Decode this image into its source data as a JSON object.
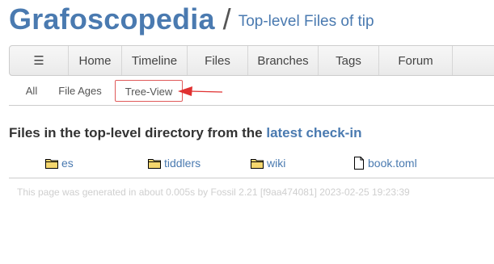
{
  "header": {
    "site_title": "Grafoscopedia",
    "separator": "/",
    "page_title": "Top-level Files of tip"
  },
  "mainmenu": {
    "hamburger": "☰",
    "items": [
      "Home",
      "Timeline",
      "Files",
      "Branches",
      "Tags",
      "Forum"
    ]
  },
  "submenu": {
    "items": [
      "All",
      "File Ages",
      "Tree-View"
    ],
    "active": "Tree-View"
  },
  "section": {
    "heading_text": "Files in the top-level directory from the ",
    "heading_link": "latest check-in"
  },
  "files": [
    {
      "name": "es",
      "type": "folder",
      "icon": "folder-icon"
    },
    {
      "name": "tiddlers",
      "type": "folder",
      "icon": "folder-icon"
    },
    {
      "name": "wiki",
      "type": "folder",
      "icon": "folder-icon"
    },
    {
      "name": "book.toml",
      "type": "file",
      "icon": "file-icon"
    }
  ],
  "footer": {
    "text": "This page was generated in about 0.005s by Fossil 2.21 [f9aa474081] 2023-02-25 19:23:39"
  },
  "colors": {
    "link": "#4a7ab0",
    "annotation": "#e03030",
    "folder_fill": "#f5d76e"
  }
}
